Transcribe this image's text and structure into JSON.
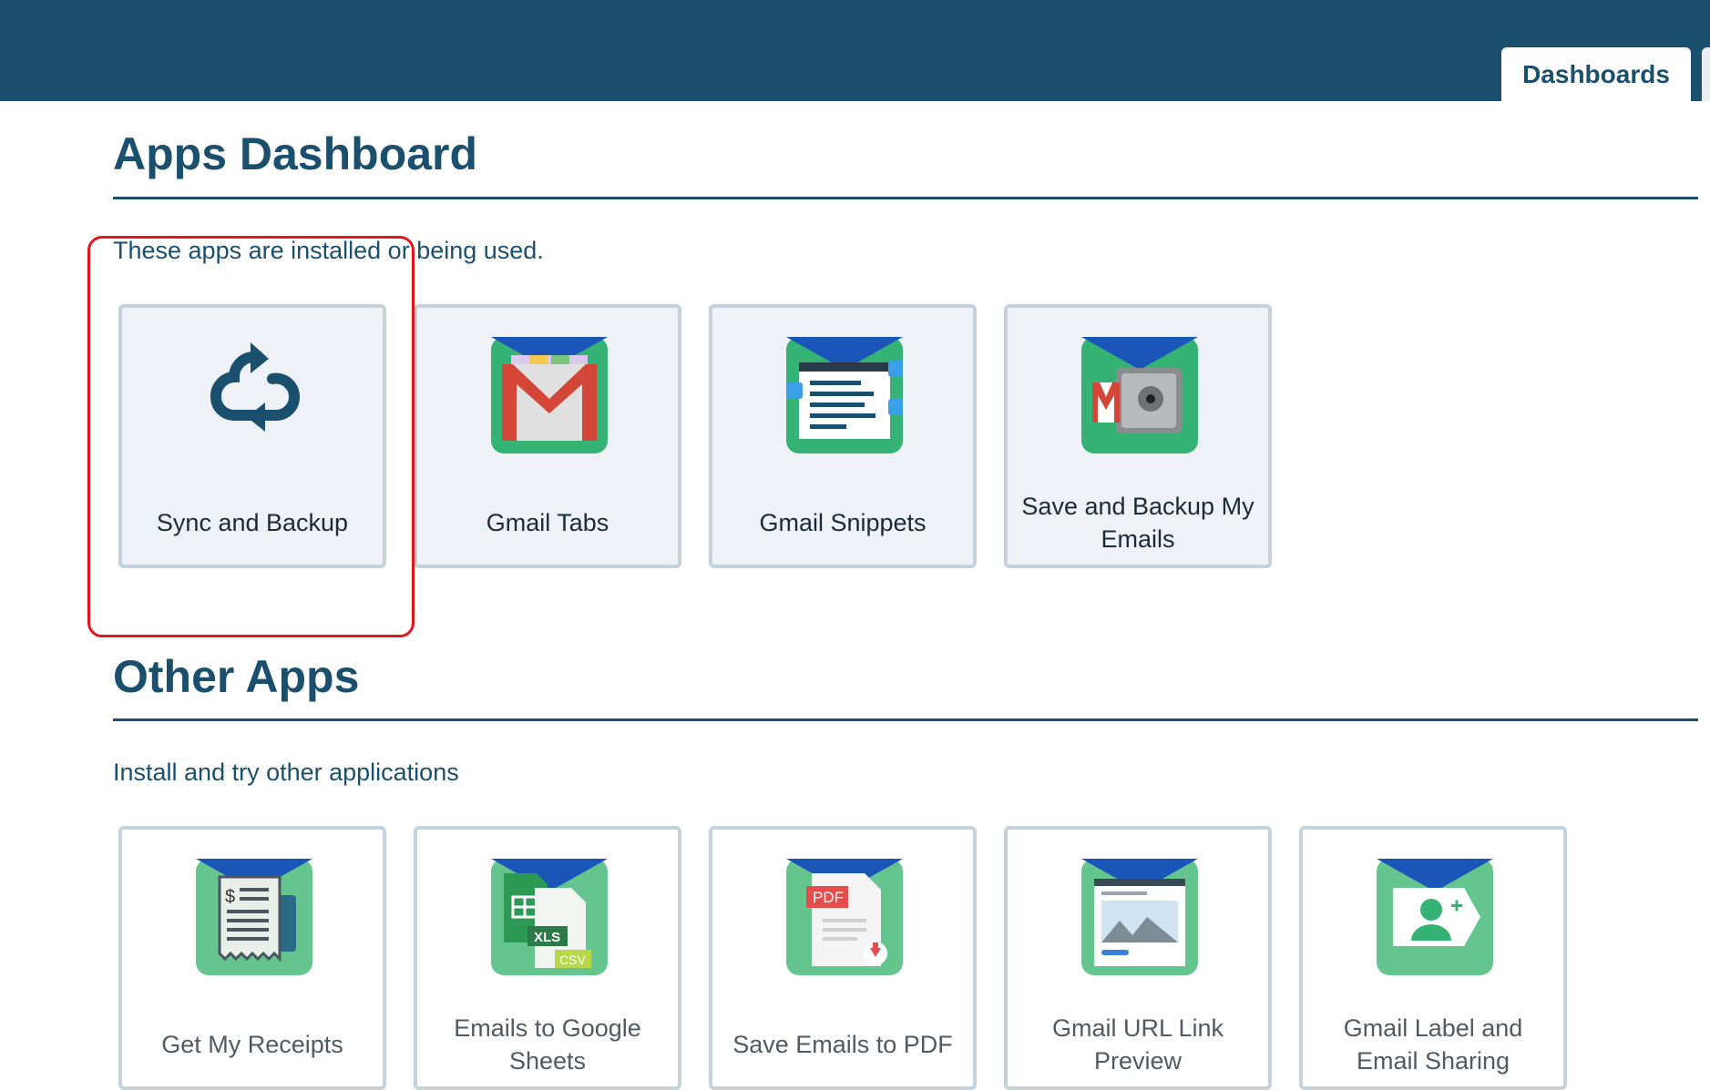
{
  "header": {
    "tabs": [
      {
        "label": "Dashboards",
        "active": true
      }
    ]
  },
  "apps_dashboard": {
    "title": "Apps Dashboard",
    "subtitle": "These apps are installed or being used.",
    "apps": [
      {
        "label": "Sync and Backup",
        "icon": "cloud-sync-icon"
      },
      {
        "label": "Gmail Tabs",
        "icon": "gmail-tabs-icon"
      },
      {
        "label": "Gmail Snippets",
        "icon": "gmail-snippets-icon"
      },
      {
        "label": "Save and Backup My Emails",
        "icon": "email-vault-icon"
      }
    ]
  },
  "other_apps": {
    "title": "Other Apps",
    "subtitle": "Install and try other applications",
    "apps": [
      {
        "label": "Get My Receipts",
        "icon": "receipt-icon"
      },
      {
        "label": "Emails to Google Sheets",
        "icon": "spreadsheet-export-icon"
      },
      {
        "label": "Save Emails to PDF",
        "icon": "pdf-icon"
      },
      {
        "label": "Gmail URL Link Preview",
        "icon": "link-preview-icon"
      },
      {
        "label": "Gmail Label and Email Sharing",
        "icon": "label-share-icon"
      }
    ]
  },
  "colors": {
    "brand": "#1b4f6e",
    "highlight": "#e3161c",
    "icon_green": "#35b374",
    "icon_blue": "#1a56b8"
  }
}
